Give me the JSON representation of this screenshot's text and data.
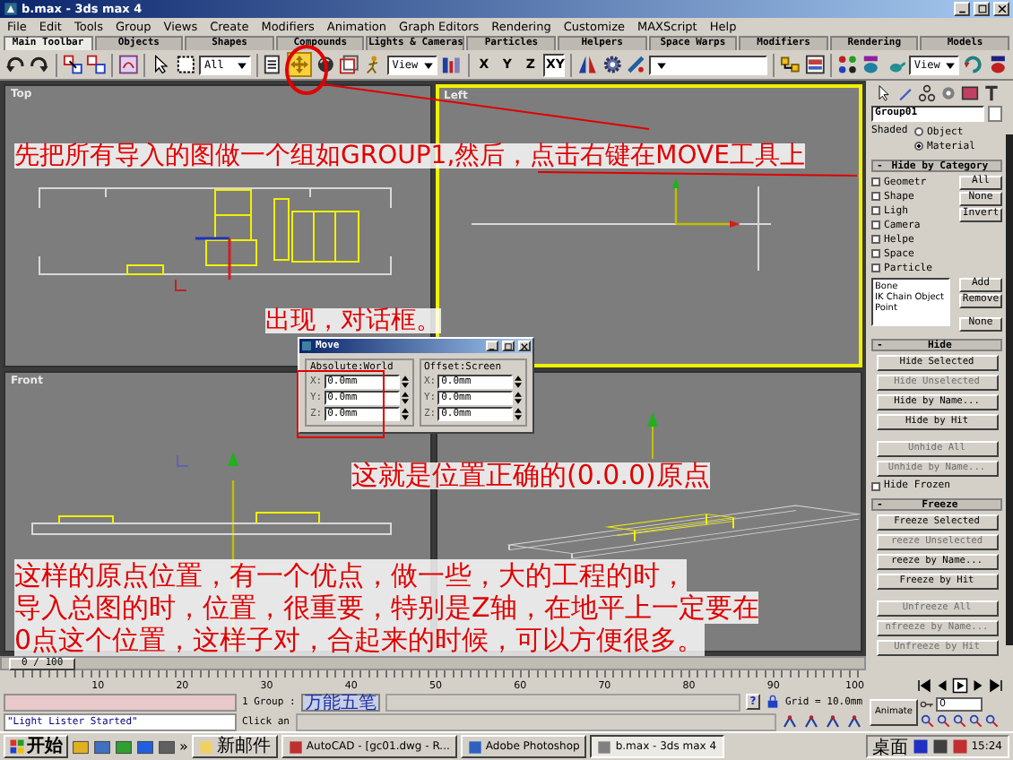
{
  "window": {
    "title": "b.max - 3ds max 4"
  },
  "menu": [
    "File",
    "Edit",
    "Tools",
    "Group",
    "Views",
    "Create",
    "Modifiers",
    "Animation",
    "Graph Editors",
    "Rendering",
    "Customize",
    "MAXScript",
    "Help"
  ],
  "tabs": [
    {
      "label": "Main Toolbar",
      "selected": true
    },
    {
      "label": "Objects",
      "selected": false
    },
    {
      "label": "Shapes",
      "selected": false
    },
    {
      "label": "Compounds",
      "selected": false
    },
    {
      "label": "Lights & Cameras",
      "selected": false
    },
    {
      "label": "Particles",
      "selected": false
    },
    {
      "label": "Helpers",
      "selected": false
    },
    {
      "label": "Space Warps",
      "selected": false
    },
    {
      "label": "Modifiers",
      "selected": false
    },
    {
      "label": "Rendering",
      "selected": false
    },
    {
      "label": "Models",
      "selected": false
    }
  ],
  "toolbar": {
    "selection_filter": "All",
    "move_tool": {
      "selected": true
    },
    "reference_coordinate": "View",
    "axis_constraints": [
      {
        "label": "X",
        "selected": false
      },
      {
        "label": "Y",
        "selected": false
      },
      {
        "label": "Z",
        "selected": false
      },
      {
        "label": "XY",
        "selected": true
      }
    ],
    "render_view": "View"
  },
  "viewports": [
    {
      "label": "Top",
      "kind": "top",
      "active": false
    },
    {
      "label": "Left",
      "kind": "left",
      "active": true
    },
    {
      "label": "Front",
      "kind": "front",
      "active": false
    },
    {
      "kind": "perspective",
      "active": false
    }
  ],
  "move_dialog": {
    "title": "Move",
    "groups": [
      {
        "label": "Absolute:World",
        "fields": [
          {
            "axis": "X:",
            "value": "0.0mm"
          },
          {
            "axis": "Y:",
            "value": "0.0mm"
          },
          {
            "axis": "Z:",
            "value": "0.0mm"
          }
        ]
      },
      {
        "label": "Offset:Screen",
        "fields": [
          {
            "axis": "X:",
            "value": "0.0mm"
          },
          {
            "axis": "Y:",
            "value": "0.0mm"
          },
          {
            "axis": "Z:",
            "value": "0.0mm"
          }
        ]
      }
    ]
  },
  "command_panel": {
    "name": "Group01",
    "shaded_label": "Shaded",
    "shaded_options": [
      {
        "label": "Object",
        "selected": false
      },
      {
        "label": "Material",
        "selected": true
      }
    ],
    "rollouts": [
      {
        "kind": "category",
        "toggle": "-",
        "title": "Hide by Category",
        "categories": [
          {
            "label": "Geometr",
            "checked": false
          },
          {
            "label": "Shape",
            "checked": false
          },
          {
            "label": "Ligh",
            "checked": false
          },
          {
            "label": "Camera",
            "checked": false
          },
          {
            "label": "Helpe",
            "checked": false
          },
          {
            "label": "Space",
            "checked": false
          },
          {
            "label": "Particle",
            "checked": false
          }
        ],
        "category_buttons": [
          "All",
          "None",
          "Invert"
        ],
        "list": [
          "Bone",
          "IK Chain Object",
          "Point"
        ],
        "list_buttons": [
          "Add",
          "Remove",
          "None"
        ]
      },
      {
        "kind": "buttons",
        "toggle": "-",
        "title": "Hide",
        "buttons": [
          {
            "label": "Hide Selected",
            "disabled": false
          },
          {
            "label": "Hide Unselected",
            "disabled": true
          },
          {
            "label": "Hide by Name...",
            "disabled": false
          },
          {
            "label": "Hide by Hit",
            "disabled": false
          },
          {
            "label": "Unhide All",
            "disabled": true
          },
          {
            "label": "Unhide by Name...",
            "disabled": true
          }
        ],
        "options": [
          {
            "label": "Hide Frozen",
            "checked": false
          }
        ]
      },
      {
        "kind": "buttons",
        "toggle": "-",
        "title": "Freeze",
        "buttons": [
          {
            "label": "Freeze Selected",
            "disabled": false
          },
          {
            "label": "reeze Unselected",
            "disabled": true
          },
          {
            "label": "reeze by Name...",
            "disabled": false
          },
          {
            "label": "Freeze by Hit",
            "disabled": false
          },
          {
            "label": "Unfreeze All",
            "disabled": true
          },
          {
            "label": "nfreeze by Name...",
            "disabled": true
          },
          {
            "label": "Unfreeze by Hit",
            "disabled": true
          }
        ]
      }
    ]
  },
  "time_slider": {
    "label": "0 / 100",
    "level": 0,
    "ticks": [
      "10",
      "20",
      "30",
      "40",
      "50",
      "60",
      "70",
      "80",
      "90",
      "100"
    ]
  },
  "status": {
    "listener": "\"Light Lister Started\"",
    "selection": "1 Group :",
    "hint": "Click an",
    "ime": "万能五笔",
    "help": "?",
    "grid": "Grid = 10.0mm"
  },
  "animation": {
    "animate": "Animate",
    "frame": "0"
  },
  "taskbar": {
    "start": "开始",
    "overflow": "»",
    "tasks": [
      {
        "label": "新邮件",
        "selected": false
      },
      {
        "label": "AutoCAD - [gc01.dwg - R...",
        "selected": false
      },
      {
        "label": "Adobe Photoshop",
        "selected": false
      },
      {
        "label": "b.max - 3ds max 4",
        "selected": true
      }
    ],
    "tray": "桌面",
    "clock": "15:24"
  },
  "annotations": [
    {
      "kind": "text",
      "text": "先把所有导入的图做一个组如GROUP1,然后，点击右键在MOVE工具上"
    },
    {
      "kind": "text",
      "text": "出现，对话框。"
    },
    {
      "kind": "text",
      "text": "这就是位置正确的(0.0.0)原点"
    },
    {
      "kind": "paragraph",
      "lines": [
        "这样的原点位置，有一个优点，做一些，大的工程的时，",
        "导入总图的时，位置，很重要，特别是Z轴，在地平上一定要在",
        "0点这个位置，这样子对，合起来的时候，可以方便很多。"
      ]
    }
  ]
}
